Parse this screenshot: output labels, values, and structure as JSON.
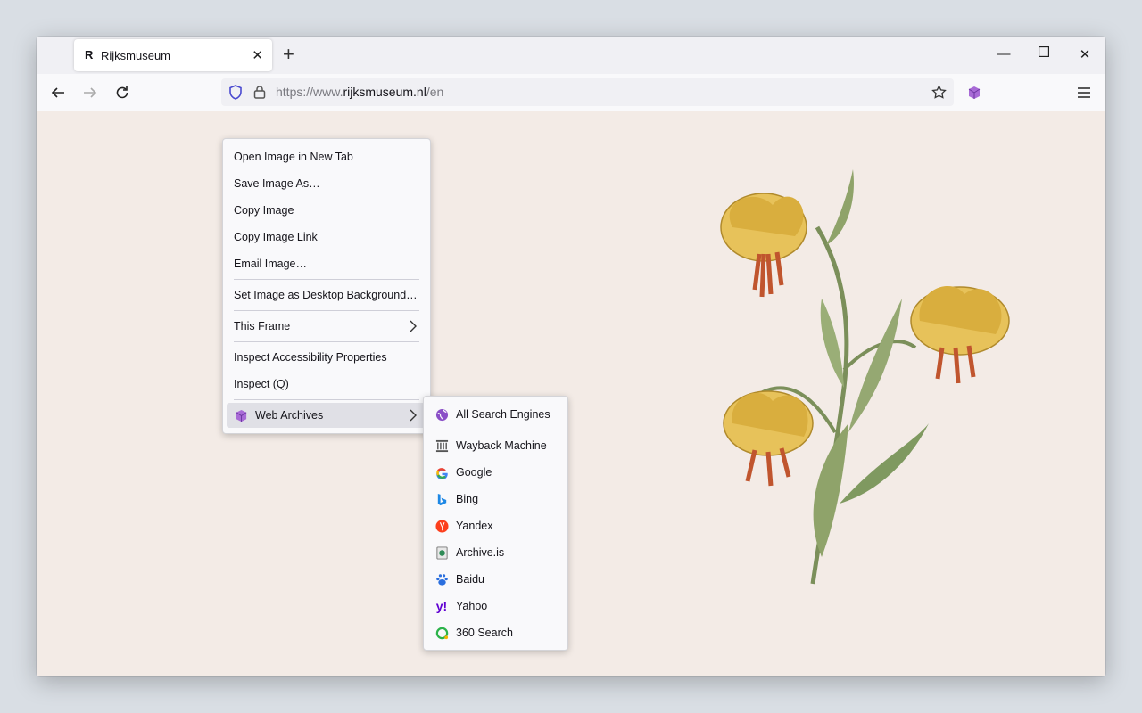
{
  "browser": {
    "tab": {
      "favicon": "R",
      "title": "Rijksmuseum"
    },
    "url": {
      "scheme": "https://www.",
      "host": "rijksmuseum.nl",
      "path": "/en"
    }
  },
  "context_menu": {
    "items": [
      "Open Image in New Tab",
      "Save Image As…",
      "Copy Image",
      "Copy Image Link",
      "Email Image…",
      "Set Image as Desktop Background…",
      "This Frame",
      "Inspect Accessibility Properties",
      "Inspect (Q)",
      "Web Archives"
    ]
  },
  "submenu": {
    "items": [
      {
        "label": "All Search Engines",
        "icon": "globe-icon",
        "color": "#8a4fc7"
      },
      {
        "label": "Wayback Machine",
        "icon": "archive-building-icon",
        "color": "#555555"
      },
      {
        "label": "Google",
        "icon": "google-icon",
        "color": "#4285f4"
      },
      {
        "label": "Bing",
        "icon": "bing-icon",
        "color": "#1e88e5"
      },
      {
        "label": "Yandex",
        "icon": "yandex-icon",
        "color": "#fc3f1d"
      },
      {
        "label": "Archive.is",
        "icon": "archive-is-icon",
        "color": "#2e8b57"
      },
      {
        "label": "Baidu",
        "icon": "baidu-icon",
        "color": "#2b6fde"
      },
      {
        "label": "Yahoo",
        "icon": "yahoo-icon",
        "color": "#6001d2"
      },
      {
        "label": "360 Search",
        "icon": "360-search-icon",
        "color": "#2cb34a"
      }
    ]
  },
  "colors": {
    "page_background": "#f3ebe6",
    "extension_accent": "#8a4fc7",
    "shield": "#4a4ad0"
  }
}
